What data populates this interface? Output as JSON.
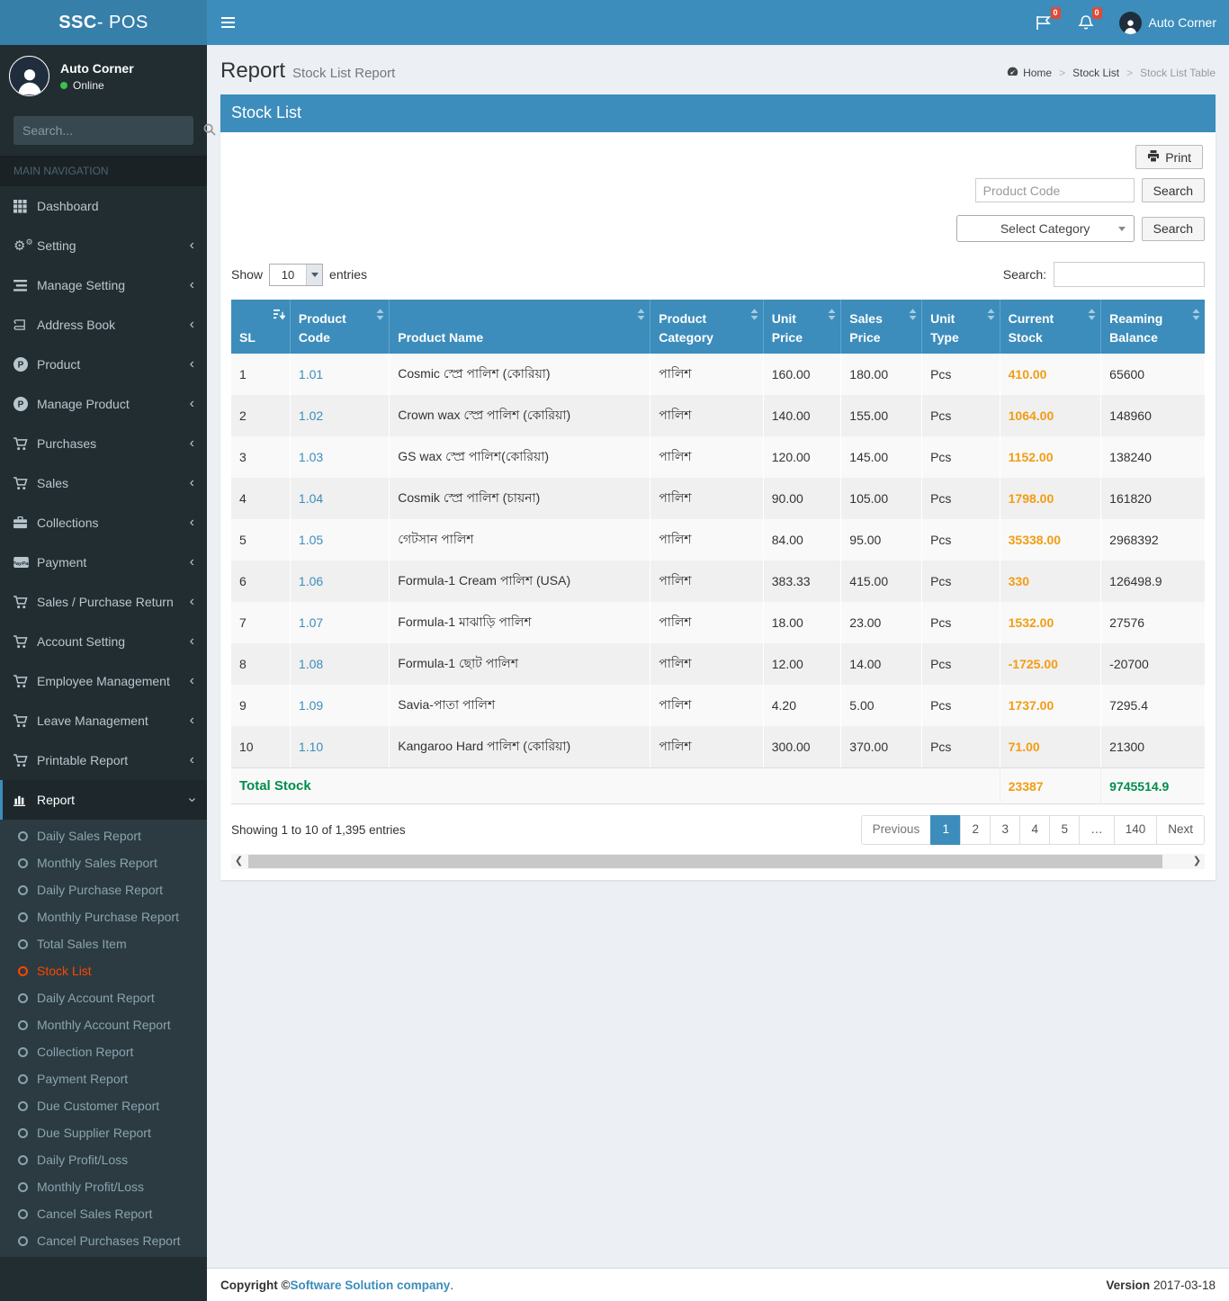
{
  "brand": {
    "name_bold": "SSC",
    "name_rest": " - POS"
  },
  "navbar": {
    "flag_badge": "0",
    "bell_badge": "0",
    "user_name": "Auto Corner"
  },
  "sidebar": {
    "user_name": "Auto Corner",
    "user_status": "Online",
    "search_placeholder": "Search...",
    "section_label": "MAIN NAVIGATION",
    "items": [
      {
        "label": "Dashboard",
        "icon": "grid-icon",
        "chevron": false
      },
      {
        "label": "Setting",
        "icon": "gears-icon",
        "chevron": true
      },
      {
        "label": "Manage Setting",
        "icon": "list-icon",
        "chevron": true
      },
      {
        "label": "Address Book",
        "icon": "book-icon",
        "chevron": true
      },
      {
        "label": "Product",
        "icon": "product-circle-icon",
        "chevron": true
      },
      {
        "label": "Manage Product",
        "icon": "product-circle-icon",
        "chevron": true
      },
      {
        "label": "Purchases",
        "icon": "cart-icon",
        "chevron": true
      },
      {
        "label": "Sales",
        "icon": "cart-icon",
        "chevron": true
      },
      {
        "label": "Collections",
        "icon": "briefcase-icon",
        "chevron": true
      },
      {
        "label": "Payment",
        "icon": "paypal-icon",
        "chevron": true
      },
      {
        "label": "Sales / Purchase Return",
        "icon": "cart-icon",
        "chevron": true
      },
      {
        "label": "Account Setting",
        "icon": "cart-icon",
        "chevron": true
      },
      {
        "label": "Employee Management",
        "icon": "cart-icon",
        "chevron": true
      },
      {
        "label": "Leave Management",
        "icon": "cart-icon",
        "chevron": true
      },
      {
        "label": "Printable Report",
        "icon": "cart-icon",
        "chevron": true
      },
      {
        "label": "Report",
        "icon": "chart-bar-icon",
        "chevron": "down",
        "active": true,
        "submenu": [
          {
            "label": "Daily Sales Report"
          },
          {
            "label": "Monthly Sales Report"
          },
          {
            "label": "Daily Purchase Report"
          },
          {
            "label": "Monthly Purchase Report"
          },
          {
            "label": "Total Sales Item"
          },
          {
            "label": "Stock List",
            "active": true
          },
          {
            "label": "Daily Account Report"
          },
          {
            "label": "Monthly Account Report"
          },
          {
            "label": "Collection Report"
          },
          {
            "label": "Payment Report"
          },
          {
            "label": "Due Customer Report"
          },
          {
            "label": "Due Supplier Report"
          },
          {
            "label": "Daily Profit/Loss"
          },
          {
            "label": "Monthly Profit/Loss"
          },
          {
            "label": "Cancel Sales Report"
          },
          {
            "label": "Cancel Purchases Report"
          }
        ]
      }
    ]
  },
  "content_header": {
    "title": "Report",
    "subtitle": "Stock List Report",
    "breadcrumb": {
      "0": "Home",
      "1": "Stock List",
      "2": "Stock List Table"
    }
  },
  "panel": {
    "title": "Stock List",
    "print_label": "Print",
    "product_code_placeholder": "Product Code",
    "code_search_label": "Search",
    "category_placeholder": "Select Category",
    "category_search_label": "Search",
    "show_label": "Show",
    "page_length": "10",
    "entries_label": "entries",
    "search_label": "Search:"
  },
  "table": {
    "columns": [
      "SL",
      "Product Code",
      "Product Name",
      "Product Category",
      "Unit Price",
      "Sales Price",
      "Unit Type",
      "Current Stock",
      "Reaming Balance"
    ],
    "rows": [
      {
        "sl": "1",
        "code": "1.01",
        "name": "Cosmic স্প্রে পালিশ (কোরিয়া)",
        "category": "পালিশ",
        "unit_price": "160.00",
        "sales_price": "180.00",
        "unit_type": "Pcs",
        "current_stock": "410.00",
        "reaming_balance": "65600"
      },
      {
        "sl": "2",
        "code": "1.02",
        "name": "Crown wax স্প্রে পালিশ (কোরিয়া)",
        "category": "পালিশ",
        "unit_price": "140.00",
        "sales_price": "155.00",
        "unit_type": "Pcs",
        "current_stock": "1064.00",
        "reaming_balance": "148960"
      },
      {
        "sl": "3",
        "code": "1.03",
        "name": "GS wax স্প্রে পালিশ(কোরিয়া)",
        "category": "পালিশ",
        "unit_price": "120.00",
        "sales_price": "145.00",
        "unit_type": "Pcs",
        "current_stock": "1152.00",
        "reaming_balance": "138240"
      },
      {
        "sl": "4",
        "code": "1.04",
        "name": "Cosmik স্প্রে পালিশ (চায়না)",
        "category": "পালিশ",
        "unit_price": "90.00",
        "sales_price": "105.00",
        "unit_type": "Pcs",
        "current_stock": "1798.00",
        "reaming_balance": "161820"
      },
      {
        "sl": "5",
        "code": "1.05",
        "name": "গেটসান পালিশ",
        "category": "পালিশ",
        "unit_price": "84.00",
        "sales_price": "95.00",
        "unit_type": "Pcs",
        "current_stock": "35338.00",
        "reaming_balance": "2968392"
      },
      {
        "sl": "6",
        "code": "1.06",
        "name": "Formula-1 Cream পালিশ (USA)",
        "category": "পালিশ",
        "unit_price": "383.33",
        "sales_price": "415.00",
        "unit_type": "Pcs",
        "current_stock": "330",
        "reaming_balance": "126498.9"
      },
      {
        "sl": "7",
        "code": "1.07",
        "name": "Formula-1 মাঝাড়ি পালিশ",
        "category": "পালিশ",
        "unit_price": "18.00",
        "sales_price": "23.00",
        "unit_type": "Pcs",
        "current_stock": "1532.00",
        "reaming_balance": "27576"
      },
      {
        "sl": "8",
        "code": "1.08",
        "name": "Formula-1 ছোট পালিশ",
        "category": "পালিশ",
        "unit_price": "12.00",
        "sales_price": "14.00",
        "unit_type": "Pcs",
        "current_stock": "-1725.00",
        "reaming_balance": "-20700"
      },
      {
        "sl": "9",
        "code": "1.09",
        "name": "Savia-পাতা পালিশ",
        "category": "পালিশ",
        "unit_price": "4.20",
        "sales_price": "5.00",
        "unit_type": "Pcs",
        "current_stock": "1737.00",
        "reaming_balance": "7295.4"
      },
      {
        "sl": "10",
        "code": "1.10",
        "name": "Kangaroo Hard পালিশ (কোরিয়া)",
        "category": "পালিশ",
        "unit_price": "300.00",
        "sales_price": "370.00",
        "unit_type": "Pcs",
        "current_stock": "71.00",
        "reaming_balance": "21300"
      }
    ],
    "total_label": "Total Stock",
    "total_current_stock": "23387",
    "total_reaming_balance": "9745514.9"
  },
  "pagination": {
    "info": "Showing 1 to 10 of 1,395 entries",
    "items": [
      "Previous",
      "1",
      "2",
      "3",
      "4",
      "5",
      "…",
      "140",
      "Next"
    ],
    "active": "1"
  },
  "footer": {
    "copyright_label": "Copyright ©",
    "company": "Software Solution company",
    "period": ".",
    "version_label": "Version",
    "version_value": "2017-03-18"
  }
}
